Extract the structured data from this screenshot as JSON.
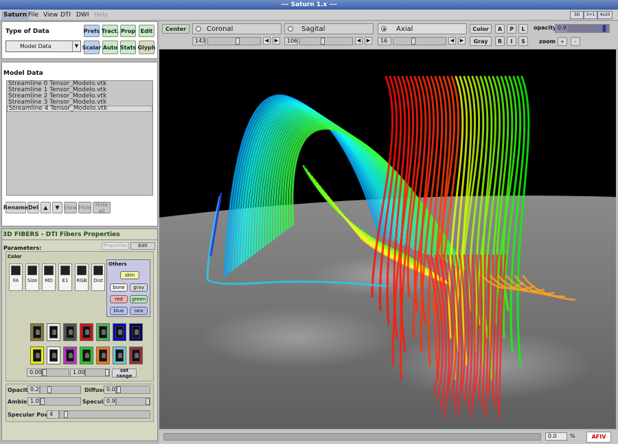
{
  "window": {
    "title": "--- Saturn 1.x ---"
  },
  "menu": {
    "items": [
      "Saturn",
      "File",
      "View",
      "DTI",
      "DWI",
      "Help"
    ]
  },
  "window_buttons": [
    "3D",
    "3+1",
    "4x20"
  ],
  "left": {
    "type_of_data": {
      "label": "Type of Data",
      "select_value": "Model Data"
    },
    "buttons_row1": [
      "Prefs",
      "Tract.",
      "Prop",
      "Edit"
    ],
    "buttons_row2": [
      "Scalar",
      "Auto",
      "Stats",
      "Glyph"
    ],
    "model_data": {
      "title": "Model Data",
      "items": [
        "Streamline 0 Tensor_Modelo.vtk",
        "Streamline 1 Tensor_Modelo.vtk",
        "Streamline 2 Tensor_Modelo.vtk",
        "Streamline 3 Tensor_Modelo.vtk",
        "Streamline 4 Tensor_Modelo.vtk"
      ]
    },
    "list_buttons": {
      "rename": "Rename",
      "del": "Del",
      "up": "▲",
      "down": "▼",
      "view": "View",
      "hide": "Hide",
      "hide_all": "Hide all"
    },
    "fibers": {
      "title": "3D FIBERS - DTI Fibers Properties",
      "params_label": "Parameters:",
      "tab_properties": "Properties",
      "tab_edit": "Edit",
      "color_label": "Color",
      "color_modes": [
        "FA",
        "Size",
        "MD",
        "E1",
        "RGB",
        "Dist"
      ],
      "others": {
        "title": "Others",
        "skin": "skin",
        "bone": "bone",
        "gray": "gray",
        "red": "red",
        "green": "green",
        "blue": "blue",
        "sea": "sea"
      },
      "range_min": "0.00",
      "range_max": "1.00",
      "set_range": "set range",
      "opacity_label": "Opacity",
      "opacity": "0.2",
      "diffuse_label": "Diffuse",
      "diffuse": "0.0",
      "ambient_label": "Ambient",
      "ambient": "1.0",
      "specular_label": "Specular",
      "specular": "0.9",
      "specular_power_label": "Specular Power",
      "specular_power": "4"
    }
  },
  "viewer": {
    "center": "Center",
    "planes": [
      {
        "label": "Coronal",
        "value": "143"
      },
      {
        "label": "Sagital",
        "value": "106"
      },
      {
        "label": "Axial",
        "value": "16"
      }
    ],
    "color_btn": "Color",
    "gray_btn": "Gray",
    "orient_top": [
      "A",
      "P",
      "L"
    ],
    "orient_bottom": [
      "R",
      "I",
      "S"
    ],
    "opacity_label": "opacity",
    "opacity_value": "0.9",
    "zoom_label": "zoom",
    "zoom_in": "+",
    "zoom_out": "-",
    "progress_value": "0.0",
    "progress_unit": "%",
    "logo": "AFIV"
  },
  "colors": {
    "swatches_row1": [
      "#8a7a3a",
      "#e8e8e8",
      "#555555",
      "#dd1111",
      "#44bb55",
      "#0000cc",
      "#000066"
    ],
    "swatches_row2": [
      "#eeee00",
      "#ffffff",
      "#bb33cc",
      "#22cc22",
      "#ff7711",
      "#66ccdd",
      "#993333"
    ]
  }
}
